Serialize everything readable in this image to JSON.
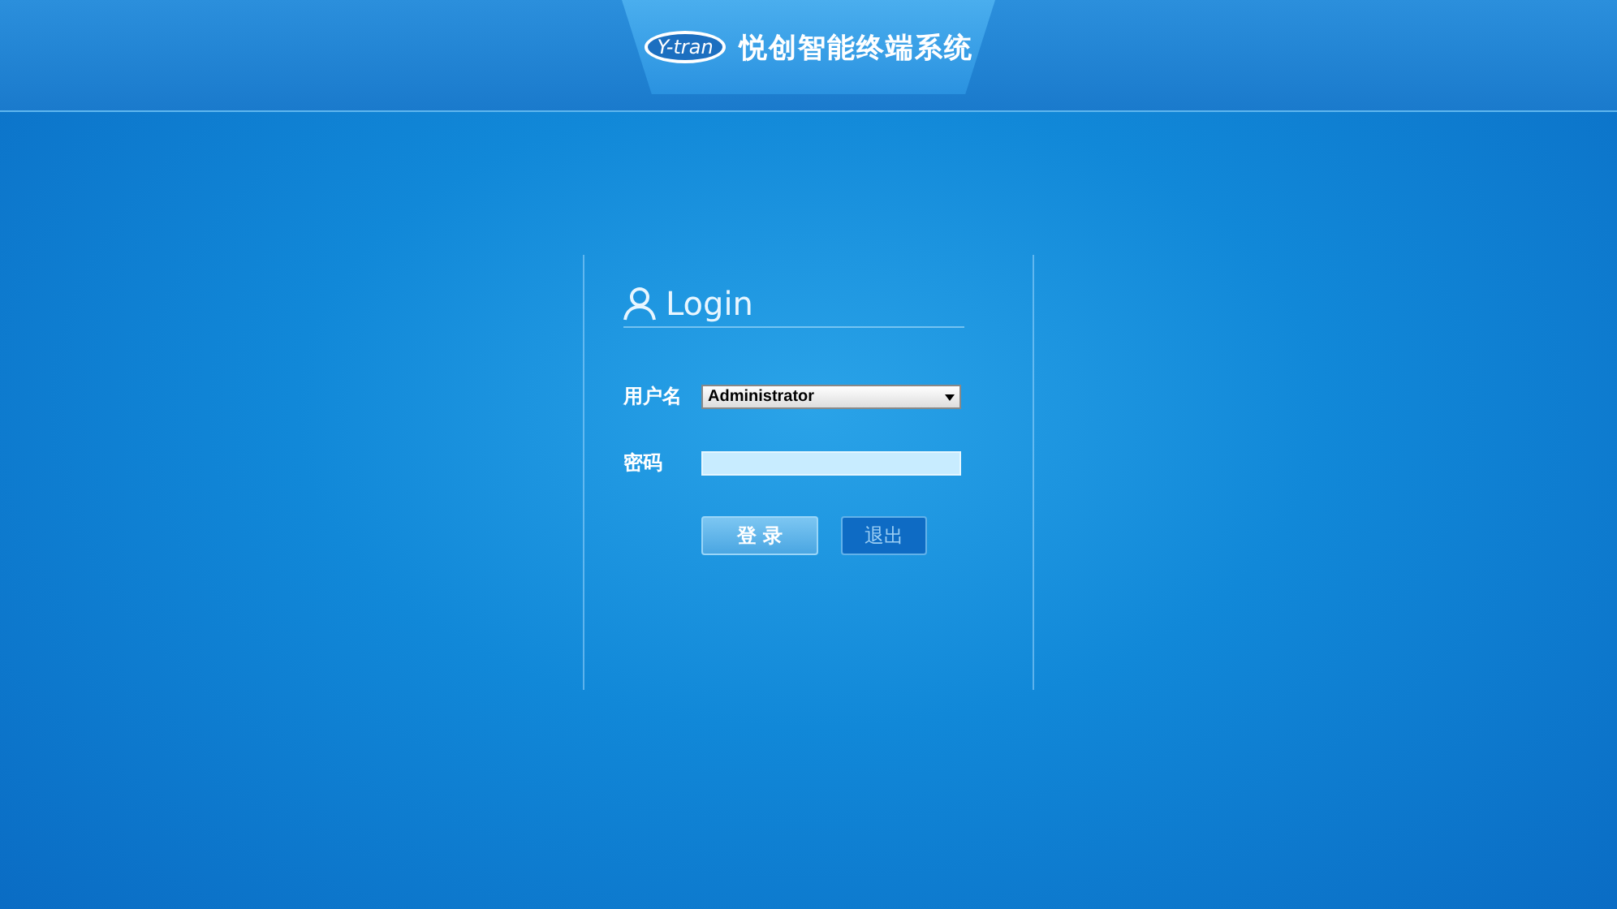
{
  "header": {
    "logo": "Y-tran",
    "title": "悦创智能终端系统"
  },
  "login": {
    "heading": "Login",
    "fields": [
      {
        "kind": "select",
        "label": "用户名",
        "value": "Administrator"
      },
      {
        "kind": "password",
        "label": "密码"
      }
    ],
    "buttons": [
      {
        "label": "登 录",
        "kind": "primary"
      },
      {
        "label": "退出",
        "kind": "secondary"
      }
    ]
  }
}
